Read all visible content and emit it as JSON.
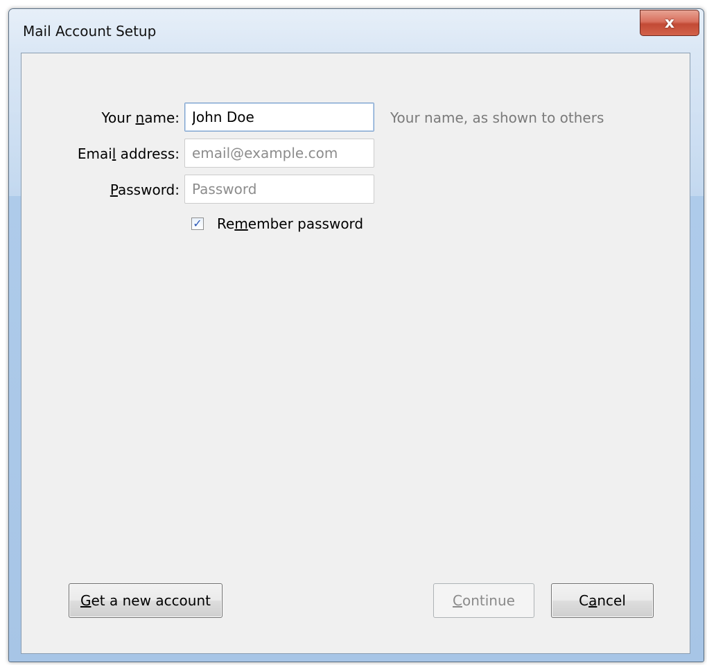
{
  "window": {
    "title": "Mail Account Setup",
    "close_glyph": "x"
  },
  "form": {
    "name": {
      "label_pre": "Your ",
      "label_accel": "n",
      "label_post": "ame:",
      "value": "John Doe",
      "hint": "Your name, as shown to others"
    },
    "email": {
      "label_pre": "Emai",
      "label_accel": "l",
      "label_post": " address:",
      "value": "",
      "placeholder": "email@example.com"
    },
    "password": {
      "label_pre": "",
      "label_accel": "P",
      "label_post": "assword:",
      "value": "",
      "placeholder": "Password"
    },
    "remember": {
      "checked": true,
      "check_glyph": "✓",
      "label_pre": "Re",
      "label_accel": "m",
      "label_post": "ember password"
    }
  },
  "buttons": {
    "get_account": {
      "label_pre": "",
      "label_accel": "G",
      "label_post": "et a new account"
    },
    "continue": {
      "label_pre": "",
      "label_accel": "C",
      "label_post": "ontinue",
      "disabled": true
    },
    "cancel": {
      "label_pre": "C",
      "label_accel": "a",
      "label_post": "ncel"
    }
  },
  "colors": {
    "title_bar": "#b9d1ec",
    "close_button": "#c24a35",
    "dialog_background": "#f0f0f0",
    "hint_text": "#7a7a7a",
    "disabled_text": "#8a8a8a"
  },
  "icons": {
    "close": "close-icon",
    "check": "checkmark-icon"
  }
}
